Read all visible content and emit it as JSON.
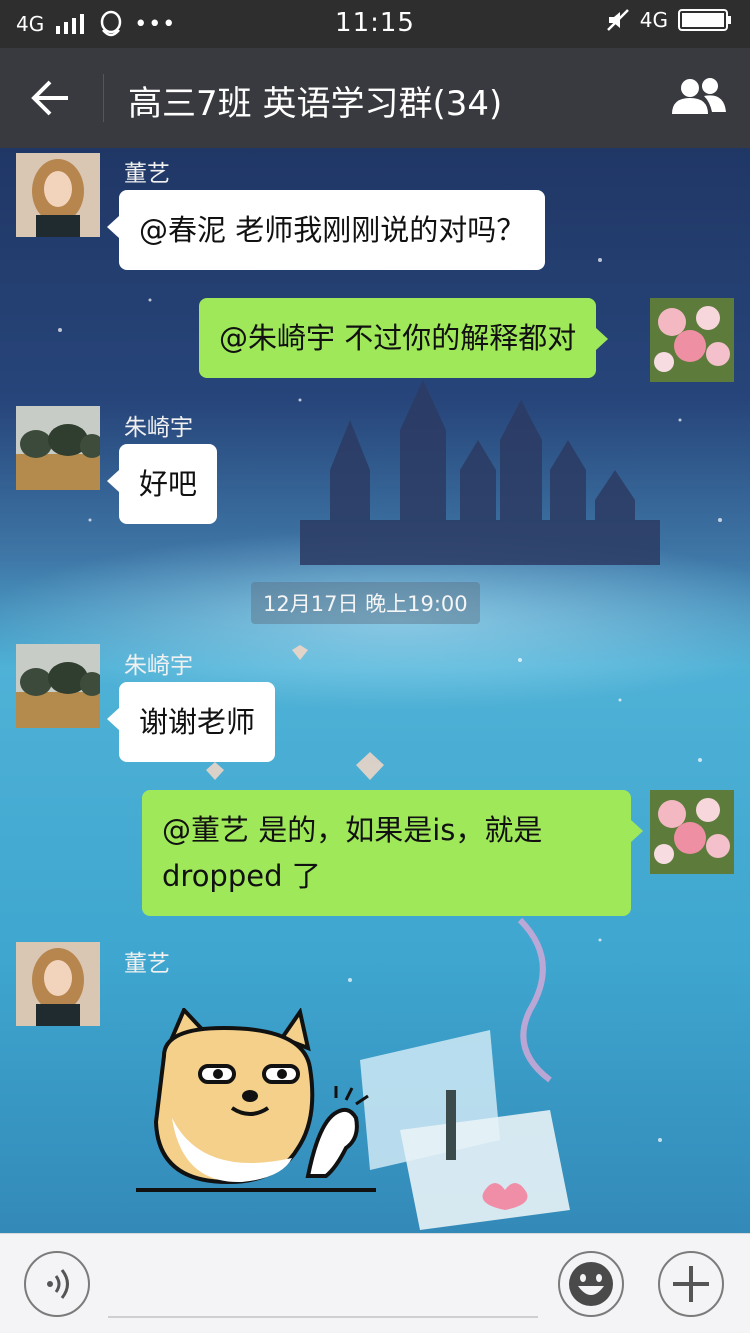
{
  "status_bar": {
    "network_left": "4G",
    "time": "11:15",
    "network_right": "4G"
  },
  "header": {
    "title": "高三7班 英语学习群(34)"
  },
  "messages": [
    {
      "sender": "董艺",
      "text": "@春泥 老师我刚刚说的对吗？"
    },
    {
      "text": "@朱崎宇 不过你的解释都对"
    },
    {
      "sender": "朱崎宇",
      "text": "好吧"
    },
    {
      "timestamp": "12月17日 晚上19:00"
    },
    {
      "sender": "朱崎宇",
      "text": "谢谢老师"
    },
    {
      "text_line1": "@董艺 是的，如果是is，就是",
      "text_line2": "dropped 了"
    },
    {
      "sender": "董艺",
      "sticker": "doge-thumbs-up-sticker"
    }
  ],
  "input_bar": {
    "placeholder": ""
  },
  "colors": {
    "title_bar": "#393a3f",
    "status_bar": "#2e2e2e",
    "incoming_bubble": "#ffffff",
    "outgoing_bubble": "#9fe85a"
  }
}
